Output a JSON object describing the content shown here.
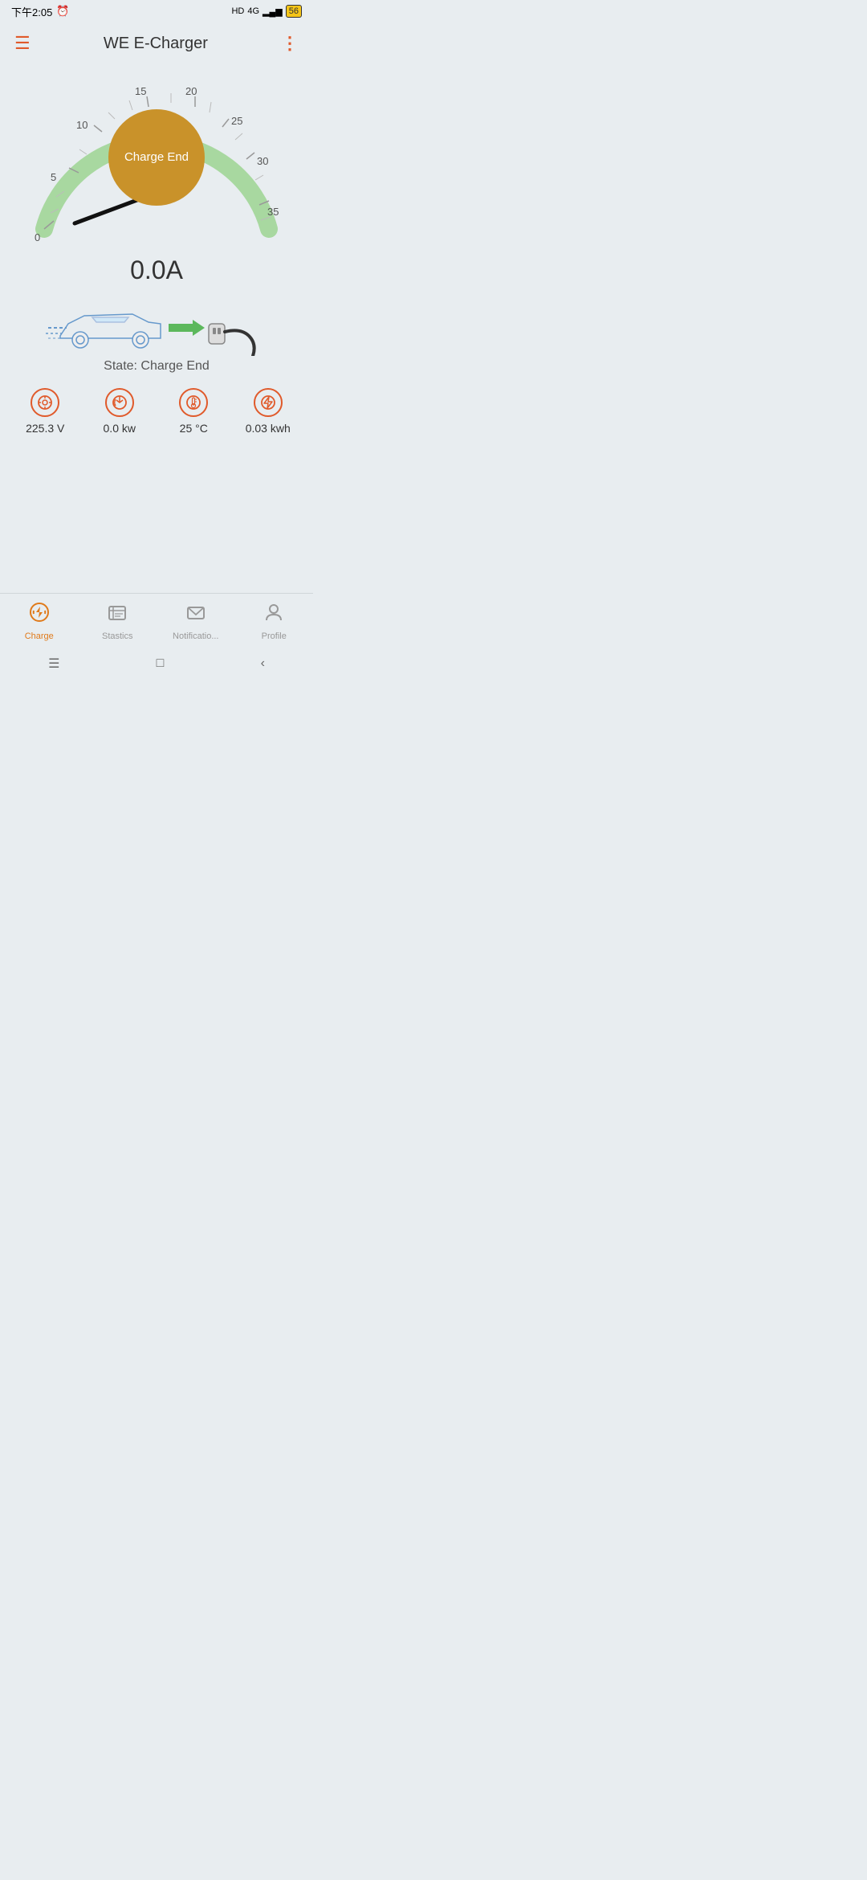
{
  "statusBar": {
    "time": "下午2:05",
    "alarmIcon": "⏰",
    "hdLabel": "HD",
    "signalLabel": "4G",
    "batteryLevel": "56"
  },
  "topBar": {
    "menuIcon": "☰",
    "title": "WE E-Charger",
    "moreIcon": "⋮"
  },
  "gauge": {
    "centerButton": "Charge End",
    "value": "0.0A",
    "ticks": [
      "0",
      "5",
      "10",
      "15",
      "20",
      "25",
      "30",
      "35"
    ],
    "stateLabel": "State: Charge End"
  },
  "metrics": [
    {
      "id": "voltage",
      "icon": "⊙",
      "value": "225.3 V"
    },
    {
      "id": "power",
      "icon": "◎",
      "value": "0.0 kw"
    },
    {
      "id": "temp",
      "icon": "🌡",
      "value": "25 °C"
    },
    {
      "id": "energy",
      "icon": "⚡",
      "value": "0.03 kwh"
    }
  ],
  "bottomNav": [
    {
      "id": "charge",
      "icon": "🔋",
      "label": "Charge",
      "active": true
    },
    {
      "id": "stastics",
      "icon": "📋",
      "label": "Stastics",
      "active": false
    },
    {
      "id": "notifications",
      "icon": "✉",
      "label": "Notificatio...",
      "active": false
    },
    {
      "id": "profile",
      "icon": "👤",
      "label": "Profile",
      "active": false
    }
  ],
  "androidBar": {
    "menuBtn": "☰",
    "homeBtn": "□",
    "backBtn": "‹"
  }
}
